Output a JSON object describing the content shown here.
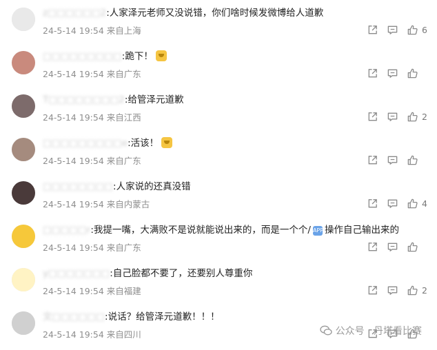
{
  "comments": [
    {
      "username": "z□□□□□□2",
      "text": "人家泽元老师又没说错，你们啥时候发微博给人道歉",
      "time": "24-5-14 19:54",
      "location": "来自上海",
      "likes": "6",
      "avatar_color": "#e9e9e9"
    },
    {
      "username": "□□□□□□□□□",
      "text": "跪下！",
      "time": "24-5-14 19:54",
      "location": "来自广东",
      "likes": "",
      "avatar_color": "#c98a7d",
      "emoji": true
    },
    {
      "username": "T□□□□□□□□2",
      "text": "给管泽元道歉",
      "time": "24-5-14 19:54",
      "location": "来自江西",
      "likes": "2",
      "avatar_color": "#7d6b6b"
    },
    {
      "username": "□□□□□□□□□e",
      "text": "活该！",
      "time": "24-5-14 19:54",
      "location": "来自广东",
      "likes": "",
      "avatar_color": "#a58b7e",
      "emoji": true
    },
    {
      "username": "□□□□□□□□",
      "text": "人家说的还真没错",
      "time": "24-5-14 19:54",
      "location": "来自内蒙古",
      "likes": "4",
      "avatar_color": "#4a3a3a"
    },
    {
      "username": "□□□□□r",
      "text_before": "我提一嘴，大满败不是说就能说出来的，而是一个个/",
      "text_after": "操作自己输出来的",
      "time": "24-5-14 19:54",
      "location": "来自广东",
      "likes": "",
      "avatar_color": "#f6c83a",
      "badge": "APP"
    },
    {
      "username": "y□□□□□□□",
      "text": "自己脸都不要了，还要别人尊重你",
      "time": "24-5-14 19:54",
      "location": "来自福建",
      "likes": "2",
      "avatar_color": "#fff3c4"
    },
    {
      "username": "文□□□□□□",
      "text": "说话？给管泽元道歉！！！",
      "time": "24-5-14 19:54",
      "location": "来自四川",
      "likes": "",
      "avatar_color": "#d0d0d0"
    }
  ],
  "watermark": {
    "text": "公众号 · 丹塔看比赛"
  }
}
